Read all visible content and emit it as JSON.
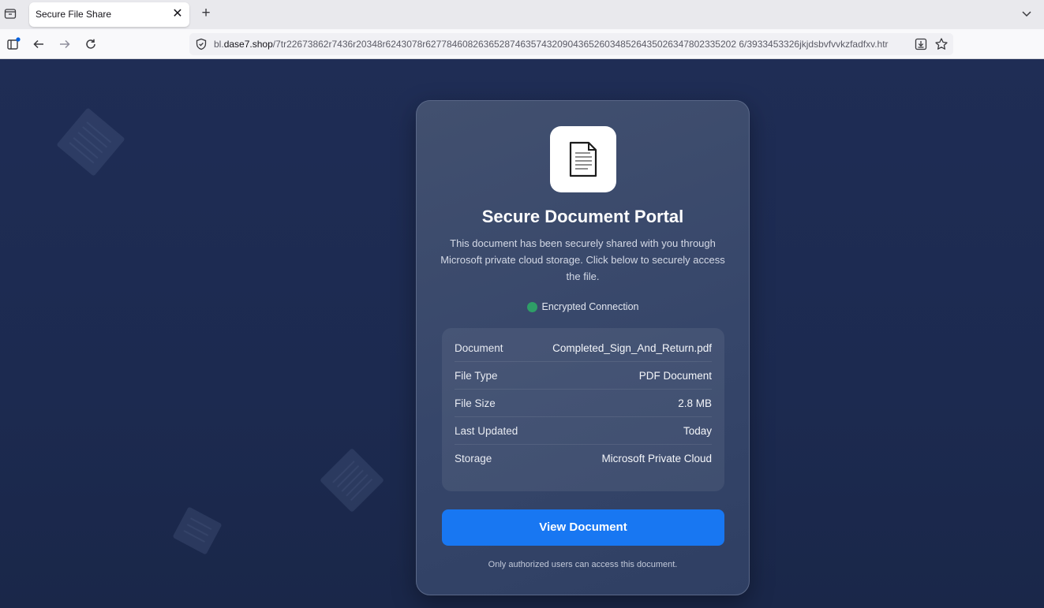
{
  "browser": {
    "tab": {
      "title": "Secure File Share"
    },
    "new_tab_label": "+",
    "close_tab_label": "✕",
    "url": {
      "prefix": "bl.",
      "domain": "dase7.shop",
      "path": "/7tr22673862r7436r20348r6243078r62778460826365287463574320904365260348526435026347802335202 6/3933453326jkjdsbvfvvkzfadfxv.htr"
    }
  },
  "card": {
    "title": "Secure Document Portal",
    "description": "This document has been securely shared with you through Microsoft private cloud storage. Click below to securely access the file.",
    "status_text": "Encrypted Connection",
    "status_color": "#2e9e67",
    "details": [
      {
        "label": "Document",
        "value": "Completed_Sign_And_Return.pdf"
      },
      {
        "label": "File Type",
        "value": "PDF Document"
      },
      {
        "label": "File Size",
        "value": "2.8 MB"
      },
      {
        "label": "Last Updated",
        "value": "Today"
      },
      {
        "label": "Storage",
        "value": "Microsoft Private Cloud"
      }
    ],
    "button_label": "View Document",
    "button_color": "#1877f2",
    "footnote": "Only authorized users can access this document."
  },
  "icons": [
    "tab-list-icon",
    "close-icon",
    "new-tab-icon",
    "tab-menu-chevron-icon",
    "sidebar-icon",
    "back-arrow-icon",
    "forward-arrow-icon",
    "reload-icon",
    "shield-icon",
    "save-page-icon",
    "bookmark-star-icon",
    "document-icon"
  ]
}
